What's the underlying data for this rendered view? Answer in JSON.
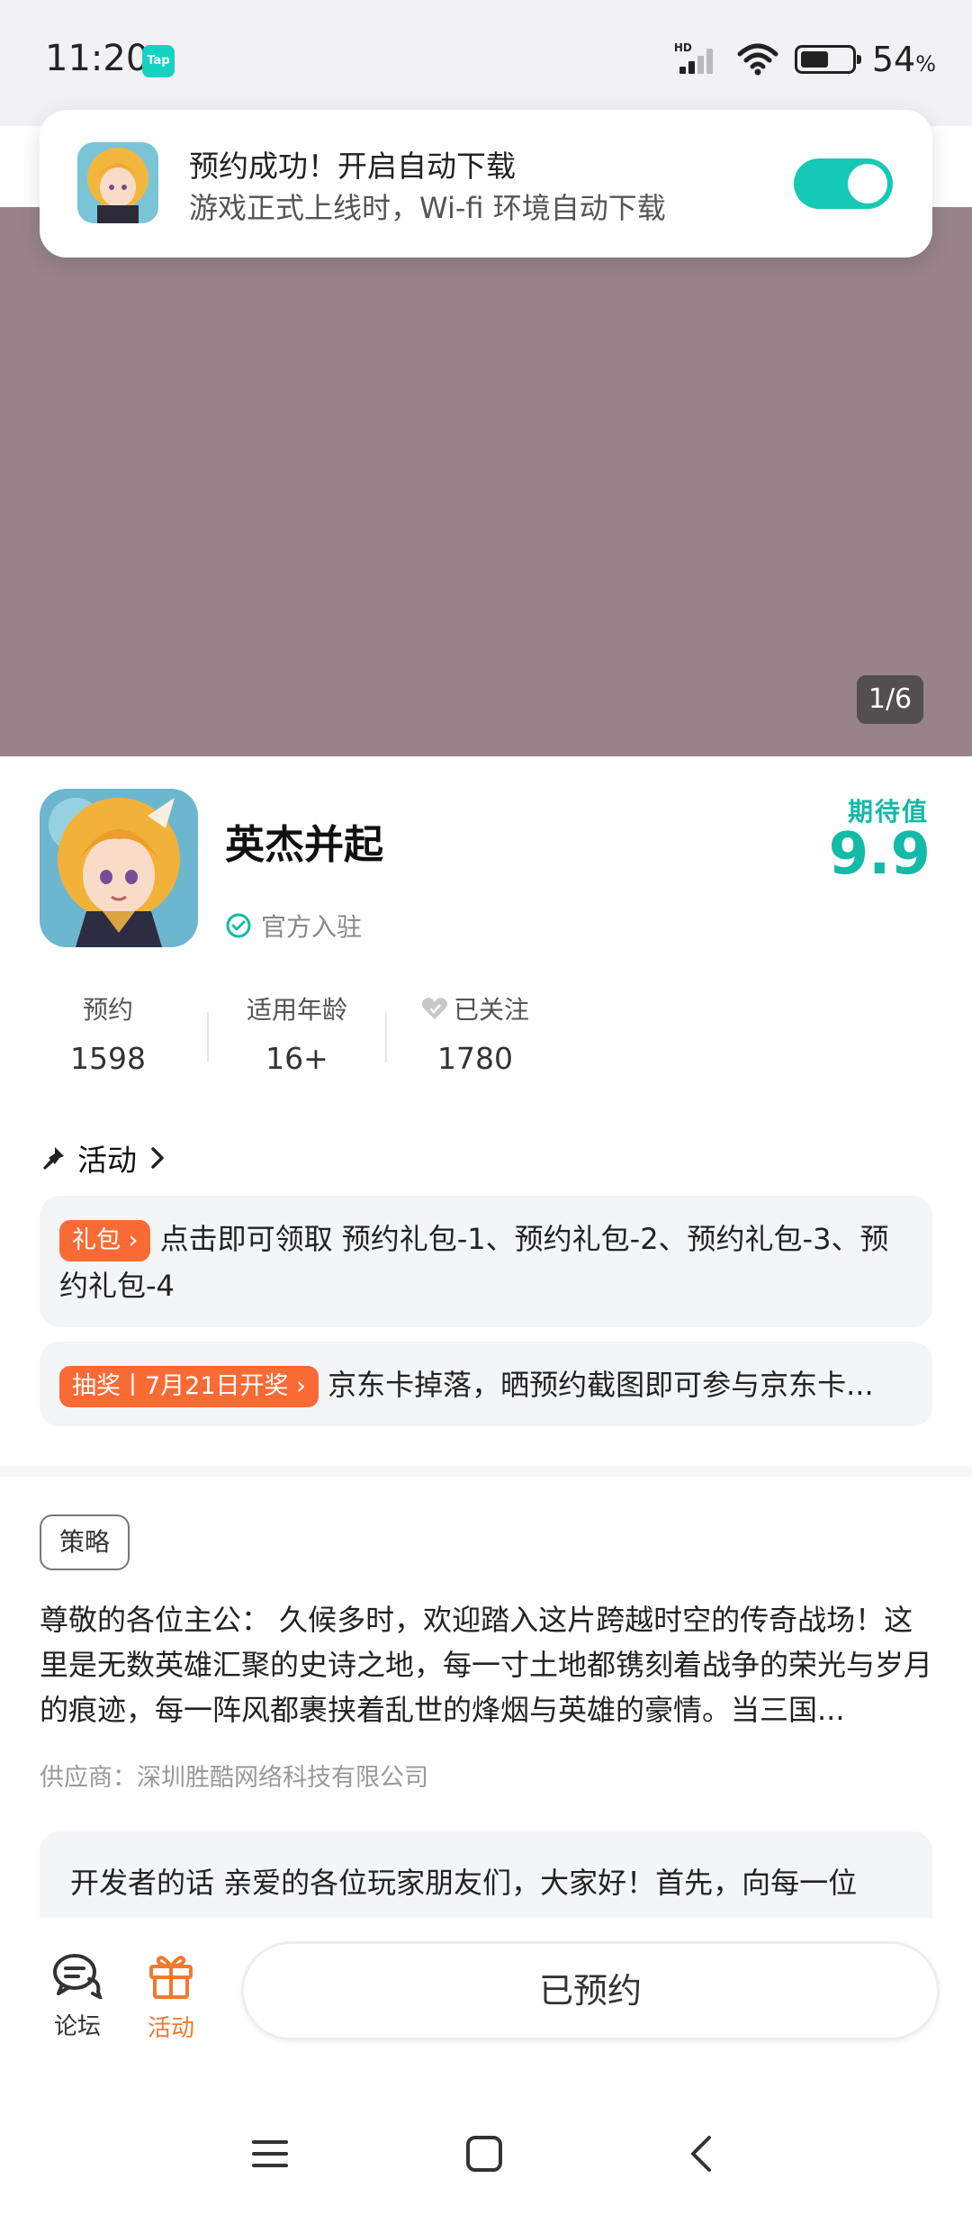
{
  "status_bar": {
    "time": "11:20",
    "app_logo": "Tap",
    "network_label": "HD",
    "battery_level": 54,
    "battery_text": "54",
    "battery_unit": "%"
  },
  "toast": {
    "title": "预约成功！开启自动下载",
    "subtitle": "游戏正式上线时，Wi-fi 环境自动下载",
    "toggle_on": true,
    "accent_color": "#14c9b6"
  },
  "hero": {
    "counter": "1/6"
  },
  "game": {
    "title": "英杰并起",
    "official_label": "官方入驻",
    "expect_label": "期待值",
    "expect_value": "9.9"
  },
  "stats": [
    {
      "label": "预约",
      "value": "1598"
    },
    {
      "label": "适用年龄",
      "value": "16+"
    },
    {
      "label": "已关注",
      "value": "1780",
      "icon": "heart-icon"
    }
  ],
  "activity": {
    "title": "活动",
    "items": [
      {
        "tag": "礼包",
        "text": "点击即可领取 预约礼包-1、预约礼包-2、预约礼包-3、预约礼包-4"
      },
      {
        "tag": "抽奖丨7月21日开奖",
        "text": "京东卡掉落，晒预约截图即可参与京东卡..."
      }
    ]
  },
  "strategy": {
    "tag": "策略",
    "description": "尊敬的各位主公：  久候多时，欢迎踏入这片跨越时空的传奇战场！这里是无数英雄汇聚的史诗之地，每一寸土地都镌刻着战争的荣光与岁月的痕迹，每一阵风都裹挟着乱世的烽烟与英雄的豪情。当三国...",
    "supplier": "供应商：深圳胜酷网络科技有限公司",
    "developer_note": "开发者的话  亲爱的各位玩家朋友们，大家好！首先，向每一位"
  },
  "bottom_bar": {
    "forum_label": "论坛",
    "activity_label": "活动",
    "reserved_label": "已预约"
  }
}
